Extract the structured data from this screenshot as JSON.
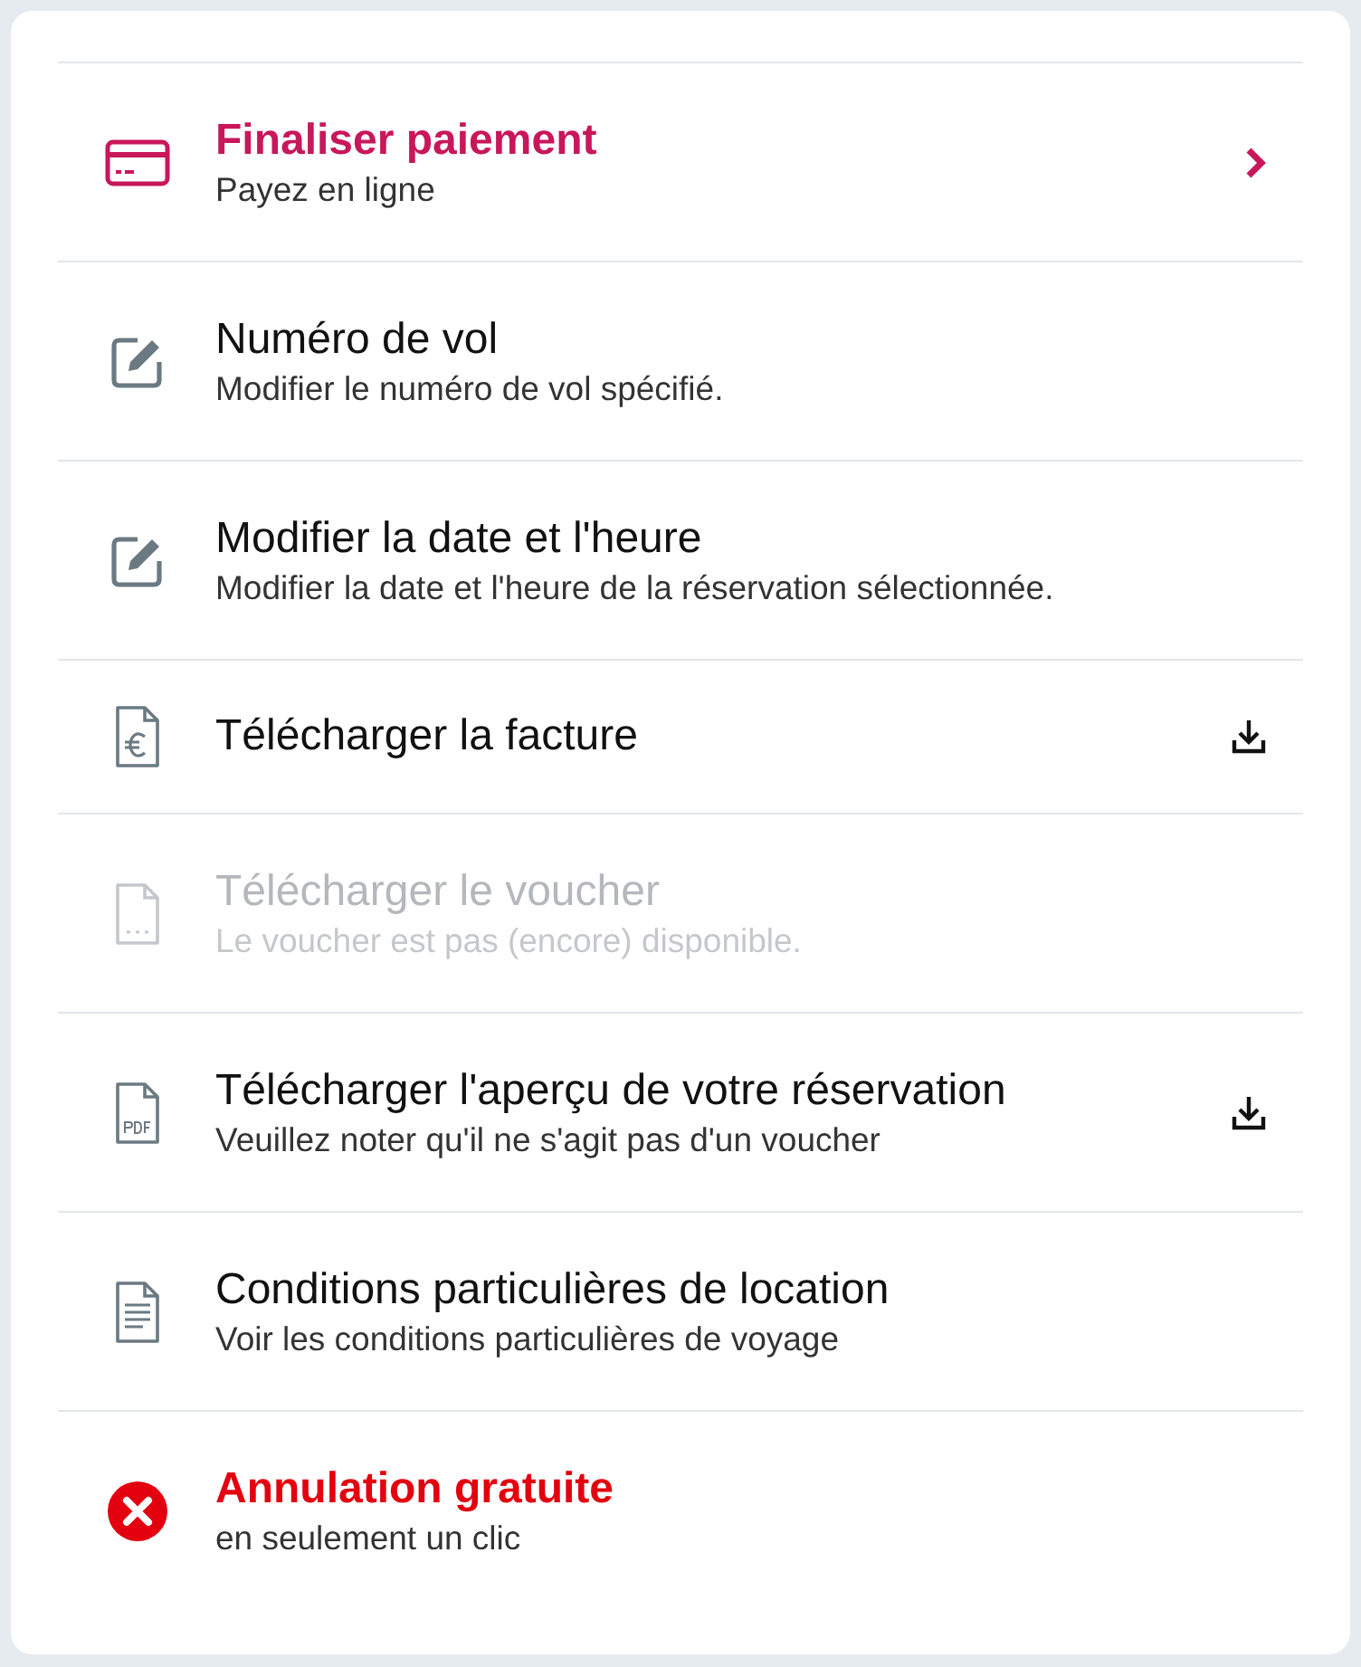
{
  "actions": [
    {
      "kind": "card",
      "color": "#c8175a",
      "emphasis": true,
      "disabled": false,
      "chevron": true,
      "download": false,
      "title": "Finaliser paiement",
      "subtitle": "Payez en ligne"
    },
    {
      "kind": "edit",
      "color": "#111111",
      "emphasis": false,
      "disabled": false,
      "chevron": false,
      "download": false,
      "title": "Numéro de vol",
      "subtitle": "Modifier le numéro de vol spécifié."
    },
    {
      "kind": "edit",
      "color": "#111111",
      "emphasis": false,
      "disabled": false,
      "chevron": false,
      "download": false,
      "title": "Modifier la date et l'heure",
      "subtitle": "Modifier la date et l'heure de la réservation sélectionnée."
    },
    {
      "kind": "invoice",
      "color": "#111111",
      "emphasis": false,
      "disabled": false,
      "chevron": false,
      "download": true,
      "title": "Télécharger la facture"
    },
    {
      "kind": "voucher",
      "emphasis": false,
      "disabled": true,
      "chevron": false,
      "download": false,
      "title": "Télécharger le voucher",
      "subtitle": "Le voucher est pas (encore) disponible."
    },
    {
      "kind": "pdf",
      "color": "#111111",
      "emphasis": false,
      "disabled": false,
      "chevron": false,
      "download": true,
      "title": "Télécharger l'aperçu de votre réservation",
      "subtitle": "Veuillez noter qu'il ne s'agit pas d'un voucher"
    },
    {
      "kind": "document",
      "color": "#111111",
      "emphasis": false,
      "disabled": false,
      "chevron": false,
      "download": false,
      "title": "Conditions particulières de location",
      "subtitle": "Voir les conditions particulières de voyage"
    },
    {
      "kind": "cancel",
      "color": "#e3000f",
      "emphasis": true,
      "disabled": false,
      "chevron": false,
      "download": false,
      "title": "Annulation gratuite",
      "subtitle": "en seulement un clic"
    }
  ]
}
